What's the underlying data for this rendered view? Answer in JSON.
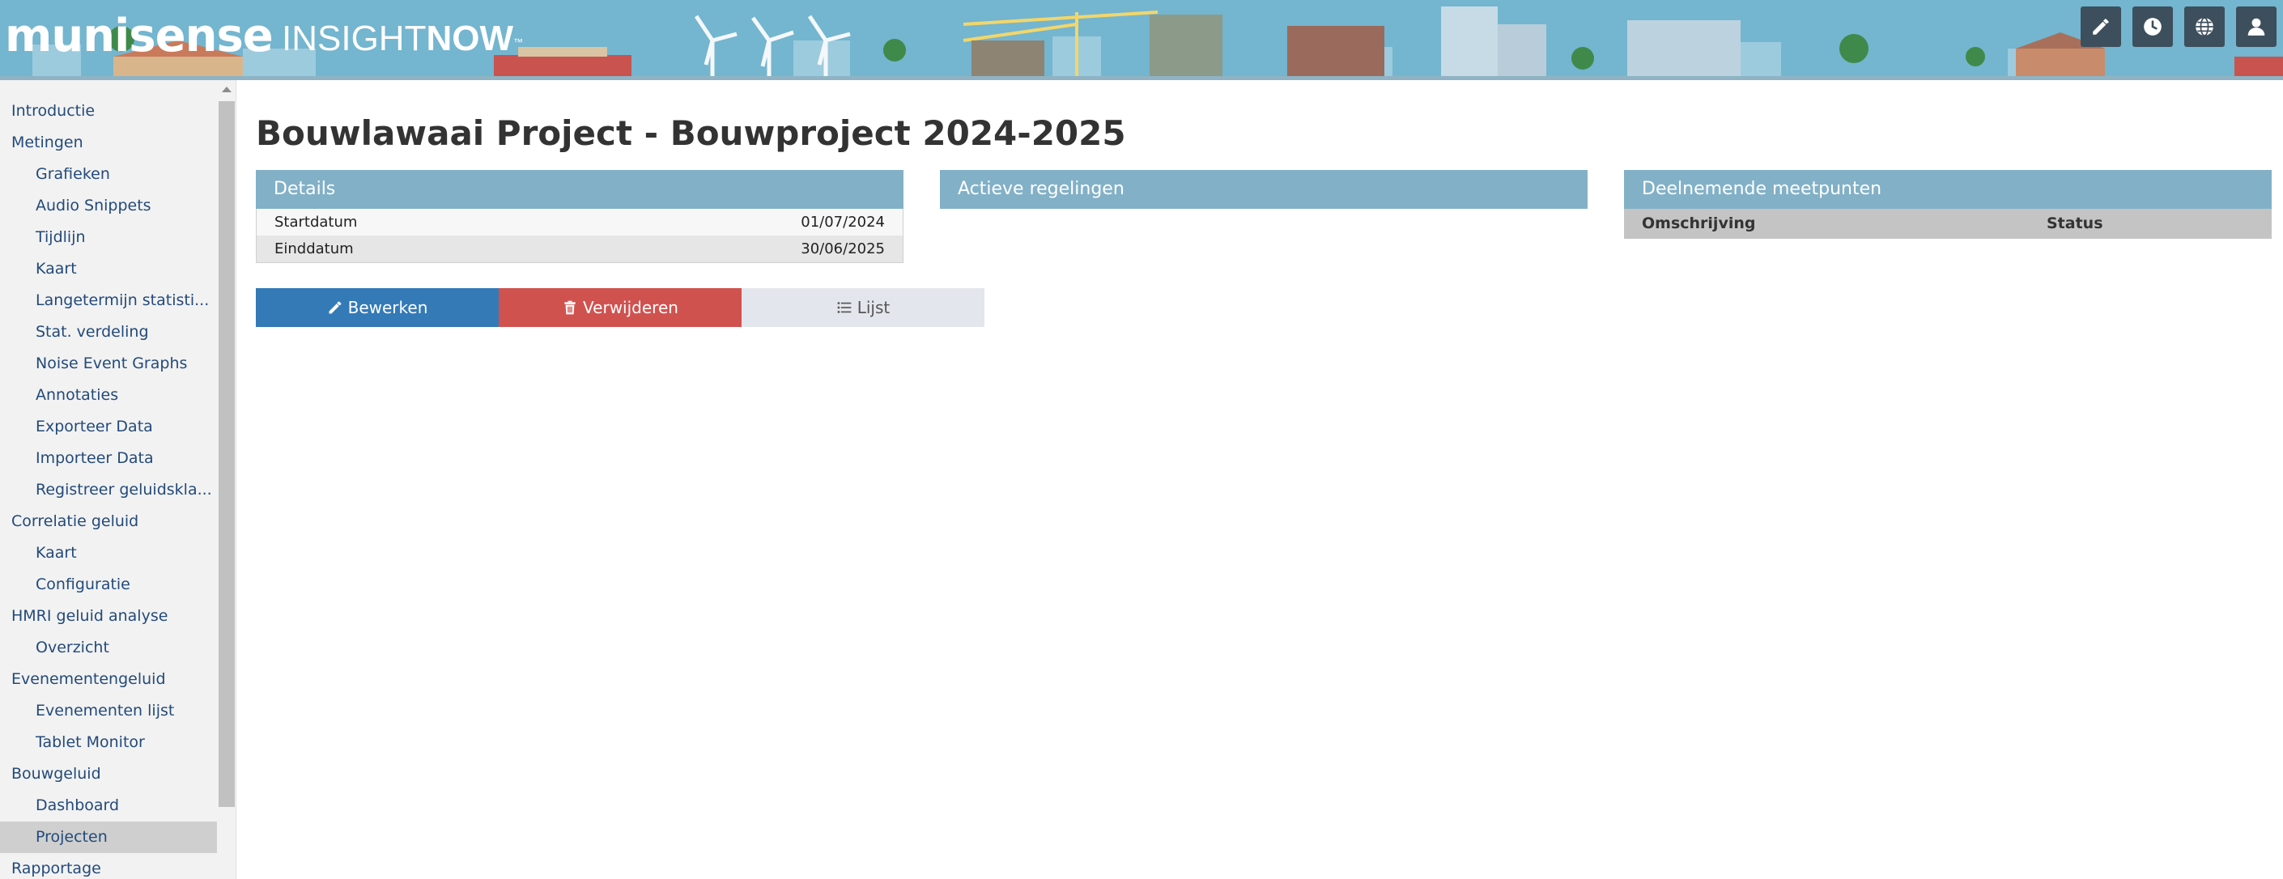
{
  "header": {
    "logo_text": "munisense",
    "product_light": "INSIGHT",
    "product_bold": "NOW",
    "product_tm": "™",
    "buttons": [
      {
        "icon": "pencil-icon"
      },
      {
        "icon": "clock-icon"
      },
      {
        "icon": "globe-icon"
      },
      {
        "icon": "user-icon"
      }
    ]
  },
  "sidebar": {
    "items": [
      {
        "label": "Introductie",
        "level": 0
      },
      {
        "label": "Metingen",
        "level": 0
      },
      {
        "label": "Grafieken",
        "level": 1
      },
      {
        "label": "Audio Snippets",
        "level": 1
      },
      {
        "label": "Tijdlijn",
        "level": 1
      },
      {
        "label": "Kaart",
        "level": 1
      },
      {
        "label": "Langetermijn statisti...",
        "level": 1
      },
      {
        "label": "Stat. verdeling",
        "level": 1
      },
      {
        "label": "Noise Event Graphs",
        "level": 1
      },
      {
        "label": "Annotaties",
        "level": 1
      },
      {
        "label": "Exporteer Data",
        "level": 1
      },
      {
        "label": "Importeer Data",
        "level": 1
      },
      {
        "label": "Registreer geluidskla...",
        "level": 1
      },
      {
        "label": "Correlatie geluid",
        "level": 0
      },
      {
        "label": "Kaart",
        "level": 1
      },
      {
        "label": "Configuratie",
        "level": 1
      },
      {
        "label": "HMRI geluid analyse",
        "level": 0
      },
      {
        "label": "Overzicht",
        "level": 1
      },
      {
        "label": "Evenementengeluid",
        "level": 0
      },
      {
        "label": "Evenementen lijst",
        "level": 1
      },
      {
        "label": "Tablet Monitor",
        "level": 1
      },
      {
        "label": "Bouwgeluid",
        "level": 0
      },
      {
        "label": "Dashboard",
        "level": 1
      },
      {
        "label": "Projecten",
        "level": 1,
        "active": true
      },
      {
        "label": "Rapportage",
        "level": 0
      }
    ]
  },
  "main": {
    "title": "Bouwlawaai Project - Bouwproject 2024-2025",
    "details": {
      "heading": "Details",
      "rows": [
        {
          "label": "Startdatum",
          "value": "01/07/2024"
        },
        {
          "label": "Einddatum",
          "value": "30/06/2025"
        }
      ]
    },
    "regelingen": {
      "heading": "Actieve regelingen"
    },
    "meetpunten": {
      "heading": "Deelnemende meetpunten",
      "columns": [
        "Omschrijving",
        "Status"
      ]
    },
    "actions": {
      "edit": "Bewerken",
      "delete": "Verwijderen",
      "list": "Lijst"
    }
  },
  "colors": {
    "banner": "#74b5cf",
    "panel_header": "#82b0c7",
    "edit_button": "#337ab7",
    "delete_button": "#d0524f",
    "list_button": "#e3e6ec",
    "link": "#234a7a"
  }
}
